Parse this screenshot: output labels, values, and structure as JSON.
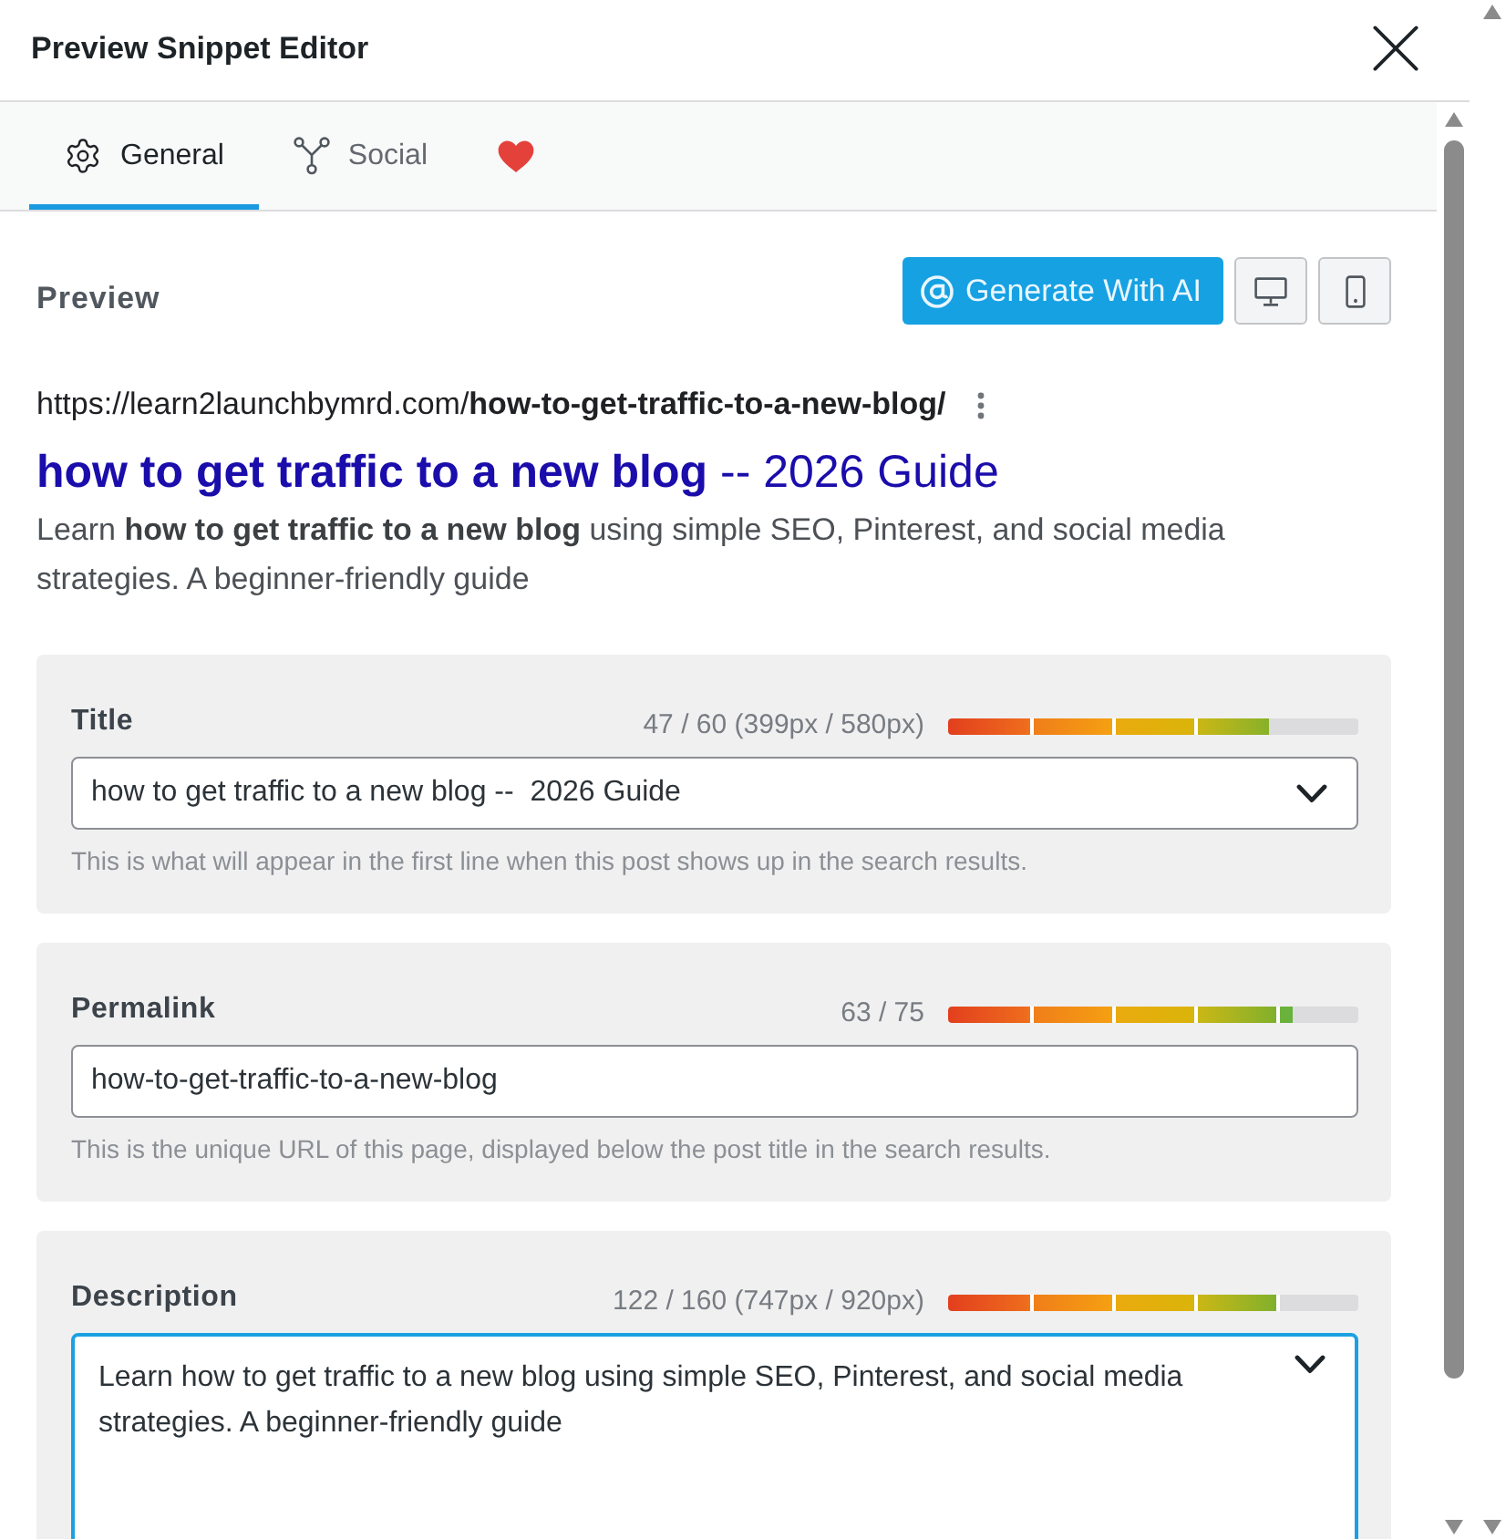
{
  "window": {
    "title": "Preview Snippet Editor"
  },
  "tabs": [
    {
      "label": "General",
      "selected": true
    },
    {
      "label": "Social",
      "selected": false
    },
    {
      "selected": false
    }
  ],
  "preview": {
    "heading": "Preview",
    "generate_button": "Generate With AI",
    "url": "https://learn2launchbymrd.com/**how-to-get-traffic-to-a-new-blog/**",
    "title": "**how to get traffic to a new blog** -- 2026 Guide",
    "description": "Learn **how to get traffic to a new blog** using simple SEO, Pinterest, and social media strategies. A beginner-friendly guide"
  },
  "fields": [
    {
      "kind": "select",
      "label": "Title",
      "counter": "47 / 60 (399px / 580px)",
      "level": 0.78,
      "value": "how to get traffic to a new blog --  2026 Guide",
      "hint": "This is what will appear in the first line when this post shows up in the search results.",
      "focused": false
    },
    {
      "kind": "text",
      "label": "Permalink",
      "counter": "63 / 75",
      "level": 0.84,
      "value": "how-to-get-traffic-to-a-new-blog",
      "hint": "This is the unique URL of this page, displayed below the post title in the search results.",
      "focused": false
    },
    {
      "kind": "textarea",
      "label": "Description",
      "counter": "122 / 160 (747px / 920px)",
      "level": 0.81,
      "value": "Learn how to get traffic to a new blog using simple SEO, Pinterest, and social media strategies. A beginner-friendly guide",
      "focused": true
    }
  ]
}
